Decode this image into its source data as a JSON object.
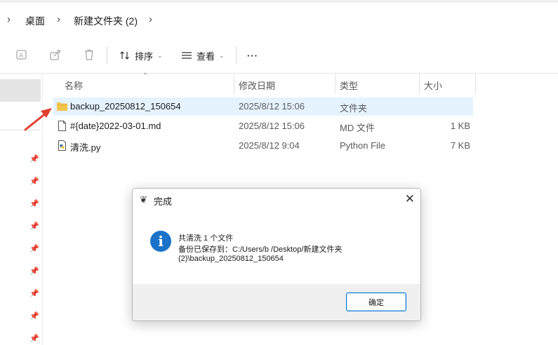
{
  "breadcrumb": {
    "items": [
      "桌面",
      "新建文件夹 (2)"
    ]
  },
  "toolbar": {
    "sort_label": "排序",
    "view_label": "查看",
    "more_label": "···"
  },
  "columns": {
    "name": "名称",
    "modified": "修改日期",
    "type": "类型",
    "size": "大小"
  },
  "files": [
    {
      "name": "backup_20250812_150654",
      "modified": "2025/8/12 15:06",
      "type": "文件夹",
      "size": "",
      "icon": "folder-icon",
      "selected": true
    },
    {
      "name": "#{date}2022-03-01.md",
      "modified": "2025/8/12 15:06",
      "type": "MD 文件",
      "size": "1 KB",
      "icon": "document-icon",
      "selected": false
    },
    {
      "name": "清洗.py",
      "modified": "2025/8/12 9:04",
      "type": "Python File",
      "size": "7 KB",
      "icon": "python-file-icon",
      "selected": false
    }
  ],
  "dialog": {
    "title": "完成",
    "line1": "共清洗 1 个文件",
    "line2": "备份已保存到：C:/Users/b                    /Desktop/新建文件夹",
    "line3": "(2)\\backup_20250812_150654",
    "ok_label": "确定"
  },
  "colors": {
    "accent": "#0078d4",
    "selection": "#e5f3ff",
    "folder": "#f4c54c",
    "info": "#1a73c8",
    "arrow": "#e0402f"
  }
}
